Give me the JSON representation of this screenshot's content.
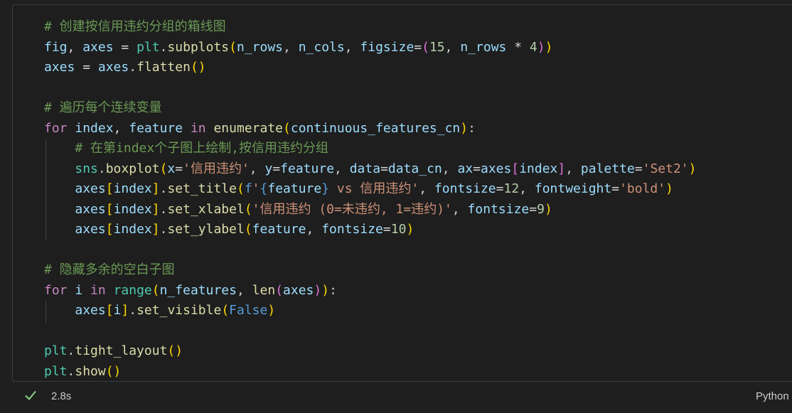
{
  "code_lines": [
    [
      [
        "cmt",
        "# 创建按信用违约分组的箱线图"
      ]
    ],
    [
      [
        "var",
        "fig"
      ],
      [
        "pun",
        ", "
      ],
      [
        "var",
        "axes"
      ],
      [
        "op",
        " = "
      ],
      [
        "cls",
        "plt"
      ],
      [
        "pun",
        "."
      ],
      [
        "fn",
        "subplots"
      ],
      [
        "b1",
        "("
      ],
      [
        "var",
        "n_rows"
      ],
      [
        "pun",
        ", "
      ],
      [
        "var",
        "n_cols"
      ],
      [
        "pun",
        ", "
      ],
      [
        "var",
        "figsize"
      ],
      [
        "op",
        "="
      ],
      [
        "b2",
        "("
      ],
      [
        "num",
        "15"
      ],
      [
        "pun",
        ", "
      ],
      [
        "var",
        "n_rows"
      ],
      [
        "op",
        " * "
      ],
      [
        "num",
        "4"
      ],
      [
        "b2",
        ")"
      ],
      [
        "b1",
        ")"
      ]
    ],
    [
      [
        "var",
        "axes"
      ],
      [
        "op",
        " = "
      ],
      [
        "var",
        "axes"
      ],
      [
        "pun",
        "."
      ],
      [
        "fn",
        "flatten"
      ],
      [
        "b1",
        "()"
      ]
    ],
    [],
    [
      [
        "cmt",
        "# 遍历每个连续变量"
      ]
    ],
    [
      [
        "kw",
        "for"
      ],
      [
        "pun",
        " "
      ],
      [
        "var",
        "index"
      ],
      [
        "pun",
        ", "
      ],
      [
        "var",
        "feature"
      ],
      [
        "pun",
        " "
      ],
      [
        "kw",
        "in"
      ],
      [
        "pun",
        " "
      ],
      [
        "fn",
        "enumerate"
      ],
      [
        "b1",
        "("
      ],
      [
        "var",
        "continuous_features_cn"
      ],
      [
        "b1",
        ")"
      ],
      [
        "pun",
        ":"
      ]
    ],
    [
      [
        "pun",
        "    "
      ],
      [
        "cmt",
        "# 在第index个子图上绘制,按信用违约分组"
      ]
    ],
    [
      [
        "pun",
        "    "
      ],
      [
        "cls",
        "sns"
      ],
      [
        "pun",
        "."
      ],
      [
        "fn",
        "boxplot"
      ],
      [
        "b1",
        "("
      ],
      [
        "var",
        "x"
      ],
      [
        "op",
        "="
      ],
      [
        "str",
        "'信用违约'"
      ],
      [
        "pun",
        ", "
      ],
      [
        "var",
        "y"
      ],
      [
        "op",
        "="
      ],
      [
        "var",
        "feature"
      ],
      [
        "pun",
        ", "
      ],
      [
        "var",
        "data"
      ],
      [
        "op",
        "="
      ],
      [
        "var",
        "data_cn"
      ],
      [
        "pun",
        ", "
      ],
      [
        "var",
        "ax"
      ],
      [
        "op",
        "="
      ],
      [
        "var",
        "axes"
      ],
      [
        "b2",
        "["
      ],
      [
        "var",
        "index"
      ],
      [
        "b2",
        "]"
      ],
      [
        "pun",
        ", "
      ],
      [
        "var",
        "palette"
      ],
      [
        "op",
        "="
      ],
      [
        "str",
        "'Set2'"
      ],
      [
        "b1",
        ")"
      ]
    ],
    [
      [
        "pun",
        "    "
      ],
      [
        "var",
        "axes"
      ],
      [
        "b1",
        "["
      ],
      [
        "var",
        "index"
      ],
      [
        "b1",
        "]"
      ],
      [
        "pun",
        "."
      ],
      [
        "fn",
        "set_title"
      ],
      [
        "b1",
        "("
      ],
      [
        "bool",
        "f"
      ],
      [
        "str",
        "'"
      ],
      [
        "bool",
        "{"
      ],
      [
        "var",
        "feature"
      ],
      [
        "bool",
        "}"
      ],
      [
        "str",
        " vs 信用违约'"
      ],
      [
        "pun",
        ", "
      ],
      [
        "var",
        "fontsize"
      ],
      [
        "op",
        "="
      ],
      [
        "num",
        "12"
      ],
      [
        "pun",
        ", "
      ],
      [
        "var",
        "fontweight"
      ],
      [
        "op",
        "="
      ],
      [
        "str",
        "'bold'"
      ],
      [
        "b1",
        ")"
      ]
    ],
    [
      [
        "pun",
        "    "
      ],
      [
        "var",
        "axes"
      ],
      [
        "b1",
        "["
      ],
      [
        "var",
        "index"
      ],
      [
        "b1",
        "]"
      ],
      [
        "pun",
        "."
      ],
      [
        "fn",
        "set_xlabel"
      ],
      [
        "b1",
        "("
      ],
      [
        "str",
        "'信用违约 (0=未违约, 1=违约)'"
      ],
      [
        "pun",
        ", "
      ],
      [
        "var",
        "fontsize"
      ],
      [
        "op",
        "="
      ],
      [
        "num",
        "9"
      ],
      [
        "b1",
        ")"
      ]
    ],
    [
      [
        "pun",
        "    "
      ],
      [
        "var",
        "axes"
      ],
      [
        "b1",
        "["
      ],
      [
        "var",
        "index"
      ],
      [
        "b1",
        "]"
      ],
      [
        "pun",
        "."
      ],
      [
        "fn",
        "set_ylabel"
      ],
      [
        "b1",
        "("
      ],
      [
        "var",
        "feature"
      ],
      [
        "pun",
        ", "
      ],
      [
        "var",
        "fontsize"
      ],
      [
        "op",
        "="
      ],
      [
        "num",
        "10"
      ],
      [
        "b1",
        ")"
      ]
    ],
    [],
    [
      [
        "cmt",
        "# 隐藏多余的空白子图"
      ]
    ],
    [
      [
        "kw",
        "for"
      ],
      [
        "pun",
        " "
      ],
      [
        "var",
        "i"
      ],
      [
        "pun",
        " "
      ],
      [
        "kw",
        "in"
      ],
      [
        "pun",
        " "
      ],
      [
        "cls",
        "range"
      ],
      [
        "b1",
        "("
      ],
      [
        "var",
        "n_features"
      ],
      [
        "pun",
        ", "
      ],
      [
        "fn",
        "len"
      ],
      [
        "b2",
        "("
      ],
      [
        "var",
        "axes"
      ],
      [
        "b2",
        ")"
      ],
      [
        "b1",
        ")"
      ],
      [
        "pun",
        ":"
      ]
    ],
    [
      [
        "pun",
        "    "
      ],
      [
        "var",
        "axes"
      ],
      [
        "b1",
        "["
      ],
      [
        "var",
        "i"
      ],
      [
        "b1",
        "]"
      ],
      [
        "pun",
        "."
      ],
      [
        "fn",
        "set_visible"
      ],
      [
        "b1",
        "("
      ],
      [
        "bool",
        "False"
      ],
      [
        "b1",
        ")"
      ]
    ],
    [],
    [
      [
        "cls",
        "plt"
      ],
      [
        "pun",
        "."
      ],
      [
        "fn",
        "tight_layout"
      ],
      [
        "b1",
        "()"
      ]
    ],
    [
      [
        "cls",
        "plt"
      ],
      [
        "pun",
        "."
      ],
      [
        "fn",
        "show"
      ],
      [
        "b1",
        "()"
      ]
    ]
  ],
  "status": {
    "duration": "2.8s",
    "language": "Python",
    "check_icon": "check-icon",
    "success_color": "#89d185"
  }
}
